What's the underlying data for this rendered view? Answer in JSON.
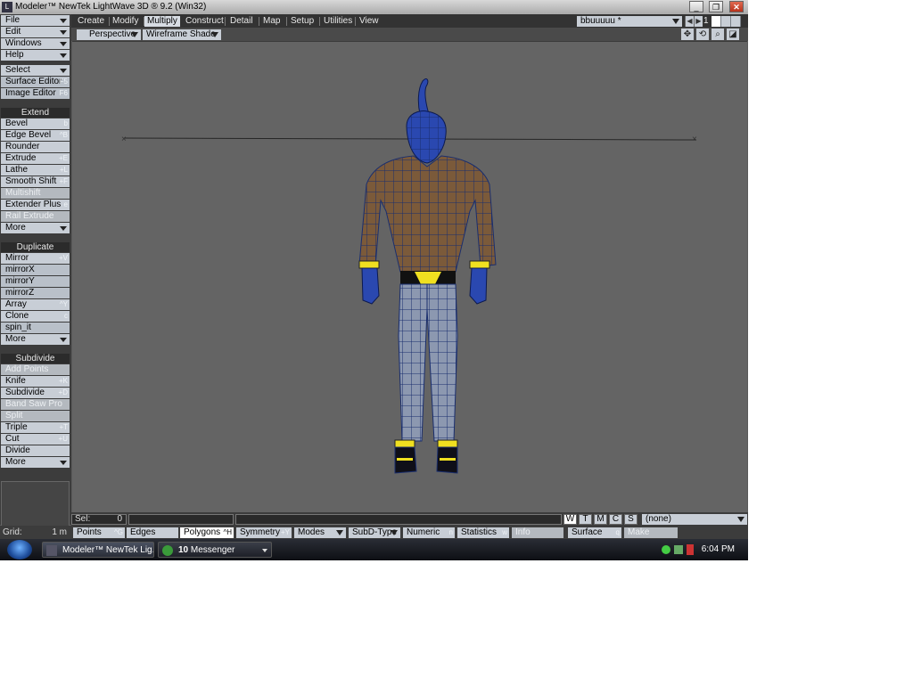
{
  "window": {
    "title": "Modeler™ NewTek LightWave 3D ® 9.2 (Win32)",
    "controls": {
      "minimize": "_",
      "maximize": "❐",
      "close": "✕"
    }
  },
  "menus": {
    "file": "File",
    "edit": "Edit",
    "windows": "Windows",
    "help": "Help"
  },
  "tools_top": {
    "select": "Select",
    "surface_editor": {
      "label": "Surface Editor",
      "shortcut": "F5"
    },
    "image_editor": {
      "label": "Image Editor",
      "shortcut": "F6"
    }
  },
  "extend": {
    "header": "Extend",
    "bevel": {
      "label": "Bevel",
      "shortcut": "b"
    },
    "edge_bevel": {
      "label": "Edge Bevel",
      "shortcut": "^B"
    },
    "rounder": {
      "label": "Rounder",
      "shortcut": ""
    },
    "extrude": {
      "label": "Extrude",
      "shortcut": "+E"
    },
    "lathe": {
      "label": "Lathe",
      "shortcut": "+L"
    },
    "smooth_shift": {
      "label": "Smooth Shift",
      "shortcut": "+F"
    },
    "multishift": {
      "label": "Multishift",
      "shortcut": ""
    },
    "extender_plus": {
      "label": "Extender Plus",
      "shortcut": "e"
    },
    "rail_extrude": {
      "label": "Rail Extrude",
      "shortcut": ""
    },
    "more": "More"
  },
  "duplicate": {
    "header": "Duplicate",
    "mirror": {
      "label": "Mirror",
      "shortcut": "+V"
    },
    "mirrorx": {
      "label": "mirrorX",
      "shortcut": ""
    },
    "mirrory": {
      "label": "mirrorY",
      "shortcut": ""
    },
    "mirrorz": {
      "label": "mirrorZ",
      "shortcut": ""
    },
    "array": {
      "label": "Array",
      "shortcut": "^Y"
    },
    "clone": {
      "label": "Clone",
      "shortcut": "c"
    },
    "spin_it": {
      "label": "spin_it",
      "shortcut": ""
    },
    "more": "More"
  },
  "subdivide": {
    "header": "Subdivide",
    "add_points": {
      "label": "Add Points",
      "shortcut": ""
    },
    "knife": {
      "label": "Knife",
      "shortcut": "+K"
    },
    "subdivide": {
      "label": "Subdivide",
      "shortcut": "+D"
    },
    "band_saw_pro": {
      "label": "Band Saw Pro",
      "shortcut": ""
    },
    "split": {
      "label": "Split",
      "shortcut": ""
    },
    "triple": {
      "label": "Triple",
      "shortcut": "+T"
    },
    "cut": {
      "label": "Cut",
      "shortcut": "+U"
    },
    "divide": {
      "label": "Divide",
      "shortcut": ""
    },
    "more": "More"
  },
  "tabs": {
    "create": "Create",
    "modify": "Modify",
    "multiply": "Multiply",
    "construct": "Construct",
    "detail": "Detail",
    "map": "Map",
    "setup": "Setup",
    "utilities": "Utilities",
    "view": "View"
  },
  "object": {
    "name": "bbuuuuu *",
    "layer_number": "1"
  },
  "viewport": {
    "view": "Perspective",
    "shading": "Wireframe Shade",
    "icons": {
      "move": "✥",
      "rotate": "⟲",
      "zoom": "⌕",
      "maximize": "◪"
    }
  },
  "status": {
    "sel_label": "Sel:",
    "sel_value": "0",
    "wtmcs": [
      "W",
      "T",
      "M",
      "C",
      "S"
    ],
    "surface_select": "(none)"
  },
  "grid": {
    "label": "Grid:",
    "value": "1 m"
  },
  "modes": {
    "points": {
      "label": "Points",
      "shortcut": "^G"
    },
    "edges": {
      "label": "Edges",
      "shortcut": ""
    },
    "polygons": {
      "label": "Polygons",
      "shortcut": "^H"
    },
    "symmetry": {
      "label": "Symmetry",
      "shortcut": "+Y"
    },
    "modes": "Modes",
    "subd_type": "SubD-Type",
    "numeric": {
      "label": "Numeric",
      "shortcut": "n"
    },
    "statistics": {
      "label": "Statistics",
      "shortcut": "w"
    },
    "info": {
      "label": "Info",
      "shortcut": ""
    },
    "surface": {
      "label": "Surface",
      "shortcut": "q"
    },
    "make": {
      "label": "Make",
      "shortcut": ""
    }
  },
  "taskbar": {
    "item1": "Modeler™ NewTek Lig...",
    "item2_count": "10",
    "item2_label": "Messenger",
    "clock": "6:04 PM"
  },
  "colors": {
    "skin": "#7b5a3a",
    "wire": "#1a2e6e",
    "trim": "#f0e020",
    "pants": "#8c98b0"
  }
}
